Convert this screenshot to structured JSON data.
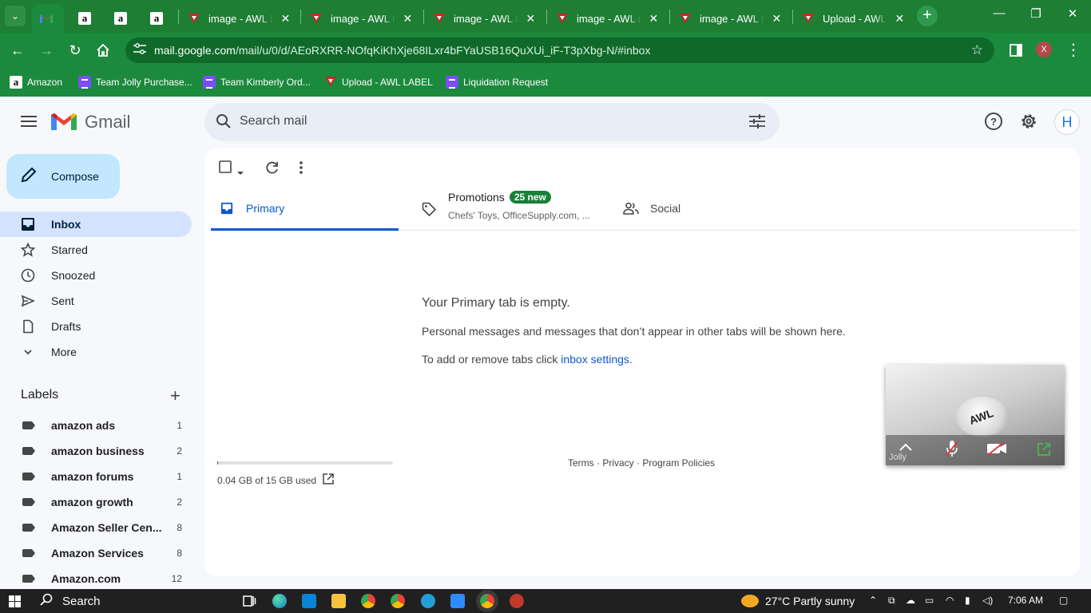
{
  "browser": {
    "tabs": [
      {
        "title": "",
        "icon": "gmail-icon"
      },
      {
        "title": "",
        "icon": "amazon-icon"
      },
      {
        "title": "",
        "icon": "amazon-icon"
      },
      {
        "title": "",
        "icon": "amazon-icon"
      },
      {
        "title": "image - AWL LA",
        "icon": "awl-icon"
      },
      {
        "title": "image - AWL LA",
        "icon": "awl-icon"
      },
      {
        "title": "image - AWL LA",
        "icon": "awl-icon"
      },
      {
        "title": "image - AWL LA",
        "icon": "awl-icon"
      },
      {
        "title": "image - AWL LA",
        "icon": "awl-icon"
      },
      {
        "title": "Upload - AWL L",
        "icon": "awl-icon"
      }
    ],
    "url_host": "mail.google.com",
    "url_path": "/mail/u/0/d/AEoRXRR-NOfqKiKhXje68ILxr4bFYaUSB16QuXUi_iF-T3pXbg-N/#inbox",
    "profile_initial": "X",
    "bookmarks": [
      {
        "label": "Amazon",
        "icon": "amazon-icon"
      },
      {
        "label": "Team Jolly Purchase...",
        "icon": "list-icon"
      },
      {
        "label": "Team Kimberly Ord...",
        "icon": "list-icon"
      },
      {
        "label": "Upload - AWL LABEL",
        "icon": "awl-icon"
      },
      {
        "label": "Liquidation Request",
        "icon": "list-icon"
      }
    ]
  },
  "gmail": {
    "logo_text": "Gmail",
    "search_placeholder": "Search mail",
    "avatar_initial": "H",
    "compose_label": "Compose",
    "nav": [
      {
        "label": "Inbox",
        "icon": "inbox-icon",
        "active": true
      },
      {
        "label": "Starred",
        "icon": "star-icon"
      },
      {
        "label": "Snoozed",
        "icon": "clock-icon"
      },
      {
        "label": "Sent",
        "icon": "send-icon"
      },
      {
        "label": "Drafts",
        "icon": "draft-icon"
      },
      {
        "label": "More",
        "icon": "chevron-down-icon"
      }
    ],
    "labels_title": "Labels",
    "labels": [
      {
        "name": "amazon ads",
        "count": "1"
      },
      {
        "name": "amazon business",
        "count": "2"
      },
      {
        "name": "amazon forums",
        "count": "1"
      },
      {
        "name": "amazon growth",
        "count": "2"
      },
      {
        "name": "Amazon Seller Cen...",
        "count": "8"
      },
      {
        "name": "Amazon Services",
        "count": "8"
      },
      {
        "name": "Amazon.com",
        "count": "12"
      }
    ],
    "tabs": {
      "primary": "Primary",
      "promotions": "Promotions",
      "promotions_badge": "25 new",
      "promotions_sub": "Chefs' Toys, OfficeSupply.com, ...",
      "social": "Social"
    },
    "empty": {
      "title": "Your Primary tab is empty.",
      "line1": "Personal messages and messages that don’t appear in other tabs will be shown here.",
      "line2_prefix": "To add or remove tabs click ",
      "line2_link": "inbox settings",
      "line2_suffix": "."
    },
    "storage_text": "0.04 GB of 15 GB used",
    "storage_fraction": 0.003,
    "footer": "Terms · Privacy · Program Policies",
    "video_name": "Jolly",
    "video_logo_text": "AWL"
  },
  "taskbar": {
    "search_label": "Search",
    "weather": "27°C  Partly sunny",
    "time": "7:06 AM"
  },
  "colors": {
    "chrome_green": "#1c8a3c",
    "gmail_bg": "#f6f8fc",
    "compose_bg": "#c2e7ff",
    "active_nav": "#d3e3fd",
    "primary_blue": "#0b57d0",
    "badge_green": "#188038"
  }
}
